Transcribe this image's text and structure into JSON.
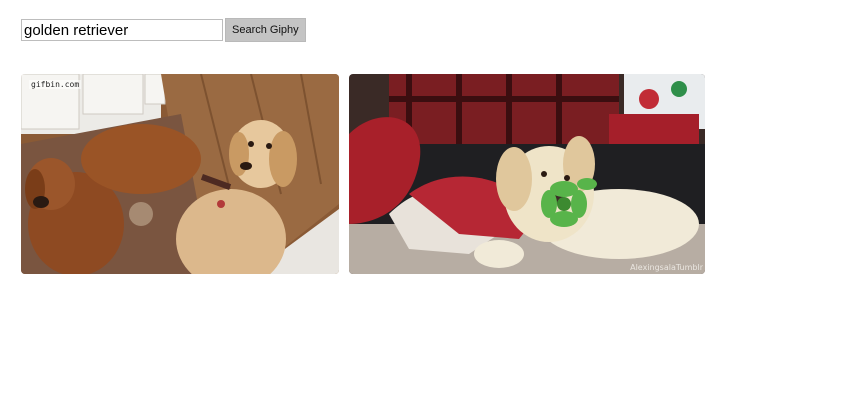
{
  "search": {
    "value": "golden retriever",
    "placeholder": "",
    "button_label": "Search Giphy"
  },
  "results": [
    {
      "watermark": "gifbin.com"
    },
    {
      "watermark": "AlexingsalaTumblr"
    }
  ]
}
